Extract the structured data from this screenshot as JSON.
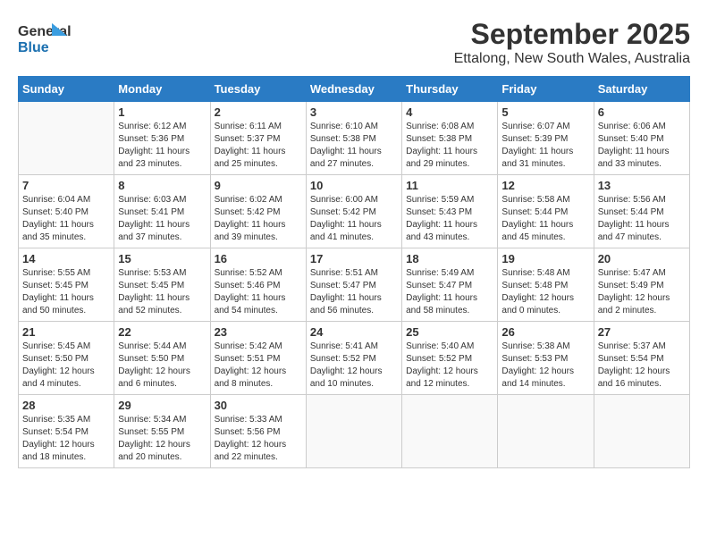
{
  "logo": {
    "line1": "General",
    "line2": "Blue"
  },
  "title": "September 2025",
  "subtitle": "Ettalong, New South Wales, Australia",
  "days_of_week": [
    "Sunday",
    "Monday",
    "Tuesday",
    "Wednesday",
    "Thursday",
    "Friday",
    "Saturday"
  ],
  "weeks": [
    [
      {
        "day": "",
        "info": ""
      },
      {
        "day": "1",
        "info": "Sunrise: 6:12 AM\nSunset: 5:36 PM\nDaylight: 11 hours\nand 23 minutes."
      },
      {
        "day": "2",
        "info": "Sunrise: 6:11 AM\nSunset: 5:37 PM\nDaylight: 11 hours\nand 25 minutes."
      },
      {
        "day": "3",
        "info": "Sunrise: 6:10 AM\nSunset: 5:38 PM\nDaylight: 11 hours\nand 27 minutes."
      },
      {
        "day": "4",
        "info": "Sunrise: 6:08 AM\nSunset: 5:38 PM\nDaylight: 11 hours\nand 29 minutes."
      },
      {
        "day": "5",
        "info": "Sunrise: 6:07 AM\nSunset: 5:39 PM\nDaylight: 11 hours\nand 31 minutes."
      },
      {
        "day": "6",
        "info": "Sunrise: 6:06 AM\nSunset: 5:40 PM\nDaylight: 11 hours\nand 33 minutes."
      }
    ],
    [
      {
        "day": "7",
        "info": "Sunrise: 6:04 AM\nSunset: 5:40 PM\nDaylight: 11 hours\nand 35 minutes."
      },
      {
        "day": "8",
        "info": "Sunrise: 6:03 AM\nSunset: 5:41 PM\nDaylight: 11 hours\nand 37 minutes."
      },
      {
        "day": "9",
        "info": "Sunrise: 6:02 AM\nSunset: 5:42 PM\nDaylight: 11 hours\nand 39 minutes."
      },
      {
        "day": "10",
        "info": "Sunrise: 6:00 AM\nSunset: 5:42 PM\nDaylight: 11 hours\nand 41 minutes."
      },
      {
        "day": "11",
        "info": "Sunrise: 5:59 AM\nSunset: 5:43 PM\nDaylight: 11 hours\nand 43 minutes."
      },
      {
        "day": "12",
        "info": "Sunrise: 5:58 AM\nSunset: 5:44 PM\nDaylight: 11 hours\nand 45 minutes."
      },
      {
        "day": "13",
        "info": "Sunrise: 5:56 AM\nSunset: 5:44 PM\nDaylight: 11 hours\nand 47 minutes."
      }
    ],
    [
      {
        "day": "14",
        "info": "Sunrise: 5:55 AM\nSunset: 5:45 PM\nDaylight: 11 hours\nand 50 minutes."
      },
      {
        "day": "15",
        "info": "Sunrise: 5:53 AM\nSunset: 5:45 PM\nDaylight: 11 hours\nand 52 minutes."
      },
      {
        "day": "16",
        "info": "Sunrise: 5:52 AM\nSunset: 5:46 PM\nDaylight: 11 hours\nand 54 minutes."
      },
      {
        "day": "17",
        "info": "Sunrise: 5:51 AM\nSunset: 5:47 PM\nDaylight: 11 hours\nand 56 minutes."
      },
      {
        "day": "18",
        "info": "Sunrise: 5:49 AM\nSunset: 5:47 PM\nDaylight: 11 hours\nand 58 minutes."
      },
      {
        "day": "19",
        "info": "Sunrise: 5:48 AM\nSunset: 5:48 PM\nDaylight: 12 hours\nand 0 minutes."
      },
      {
        "day": "20",
        "info": "Sunrise: 5:47 AM\nSunset: 5:49 PM\nDaylight: 12 hours\nand 2 minutes."
      }
    ],
    [
      {
        "day": "21",
        "info": "Sunrise: 5:45 AM\nSunset: 5:50 PM\nDaylight: 12 hours\nand 4 minutes."
      },
      {
        "day": "22",
        "info": "Sunrise: 5:44 AM\nSunset: 5:50 PM\nDaylight: 12 hours\nand 6 minutes."
      },
      {
        "day": "23",
        "info": "Sunrise: 5:42 AM\nSunset: 5:51 PM\nDaylight: 12 hours\nand 8 minutes."
      },
      {
        "day": "24",
        "info": "Sunrise: 5:41 AM\nSunset: 5:52 PM\nDaylight: 12 hours\nand 10 minutes."
      },
      {
        "day": "25",
        "info": "Sunrise: 5:40 AM\nSunset: 5:52 PM\nDaylight: 12 hours\nand 12 minutes."
      },
      {
        "day": "26",
        "info": "Sunrise: 5:38 AM\nSunset: 5:53 PM\nDaylight: 12 hours\nand 14 minutes."
      },
      {
        "day": "27",
        "info": "Sunrise: 5:37 AM\nSunset: 5:54 PM\nDaylight: 12 hours\nand 16 minutes."
      }
    ],
    [
      {
        "day": "28",
        "info": "Sunrise: 5:35 AM\nSunset: 5:54 PM\nDaylight: 12 hours\nand 18 minutes."
      },
      {
        "day": "29",
        "info": "Sunrise: 5:34 AM\nSunset: 5:55 PM\nDaylight: 12 hours\nand 20 minutes."
      },
      {
        "day": "30",
        "info": "Sunrise: 5:33 AM\nSunset: 5:56 PM\nDaylight: 12 hours\nand 22 minutes."
      },
      {
        "day": "",
        "info": ""
      },
      {
        "day": "",
        "info": ""
      },
      {
        "day": "",
        "info": ""
      },
      {
        "day": "",
        "info": ""
      }
    ]
  ]
}
